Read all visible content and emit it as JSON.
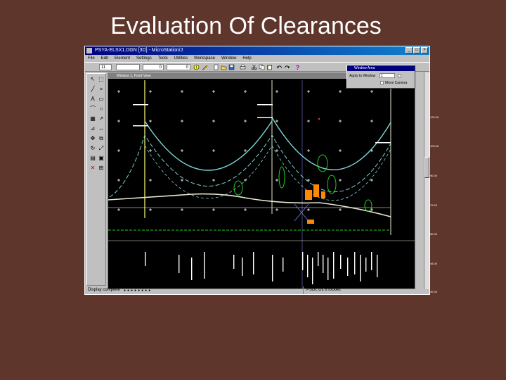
{
  "slide": {
    "title": "Evaluation Of Clearances"
  },
  "app": {
    "title": "PSYA-ELSX1.DGN [3D] - MicroStation/J",
    "menu": [
      "File",
      "Edit",
      "Element",
      "Settings",
      "Tools",
      "Utilities",
      "Workspace",
      "Window",
      "Help"
    ],
    "toolbar": {
      "level": "11",
      "weight": "0",
      "style": "0"
    }
  },
  "view": {
    "title": "Window 1, Front View",
    "ruler_labels": [
      "120.00",
      "105.00",
      "90.00",
      "75.00",
      "60.00",
      "45.00",
      "30.00"
    ]
  },
  "window_area": {
    "title": "Window Area",
    "apply_label": "Apply to Window",
    "view_number": "1",
    "camera_label": "Move Camera"
  },
  "status": {
    "left": "Display complete",
    "right": "PSDL DL 8 locked"
  },
  "colors": {
    "background": "#5e362c",
    "conductor": "#7fd6d6",
    "ground": "#e8e8d0",
    "tower": "#ffff80",
    "vegetation": "#22cc22"
  }
}
